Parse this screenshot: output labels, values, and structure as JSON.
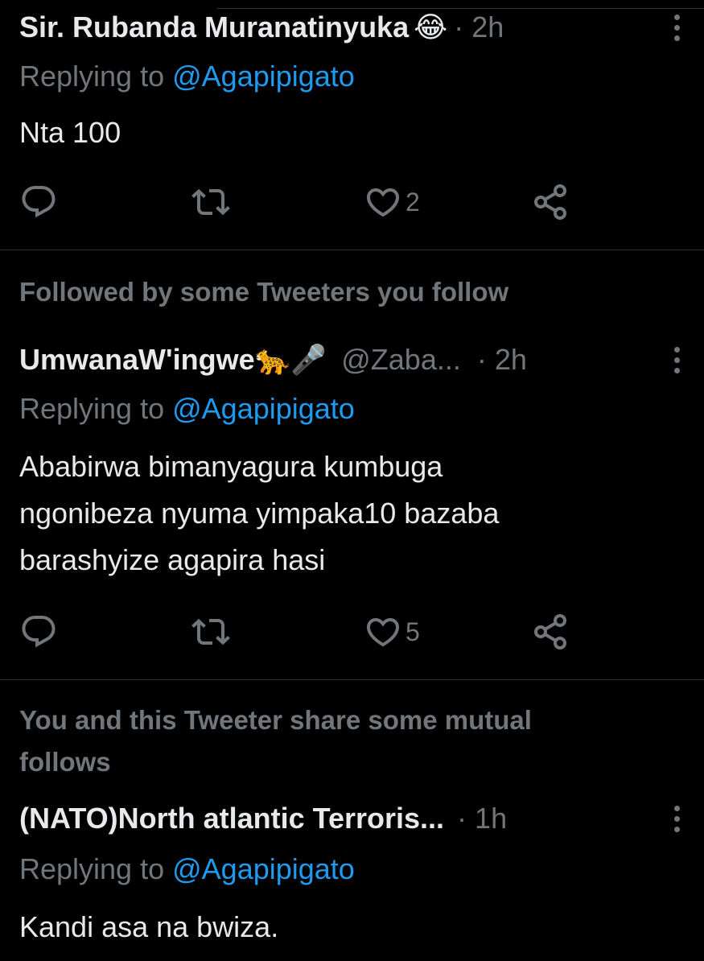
{
  "tweets": [
    {
      "name": "Sir. Rubanda Muranatinyuka",
      "emoji": "😂",
      "handle": "",
      "separator": "·",
      "time": "2h",
      "replying_prefix": "Replying to",
      "replying_to": "@Agapipigato",
      "text": "Nta 100",
      "likes": "2"
    },
    {
      "context": "Followed by some Tweeters you follow",
      "name": "UmwanaW'ingwe",
      "emoji": "🐆🎤",
      "handle": "@Zaba...",
      "separator": "·",
      "time": "2h",
      "replying_prefix": "Replying to",
      "replying_to": "@Agapipigato",
      "text_lines": [
        "Ababirwa bimanyagura kumbuga",
        "ngonibeza nyuma yimpaka10 bazaba",
        "barashyize agapira hasi"
      ],
      "likes": "5"
    },
    {
      "context_lines": [
        "You and this Tweeter share some mutual",
        "follows"
      ],
      "name": "(NATO)North atlantic Terroris...",
      "separator": "·",
      "time": "1h",
      "replying_prefix": "Replying to",
      "replying_to": "@Agapipigato",
      "text": "Kandi asa na bwiza."
    }
  ],
  "icons": {
    "reply": "reply-icon",
    "retweet": "retweet-icon",
    "like": "heart-icon",
    "share": "share-icon",
    "more": "more-icon"
  },
  "colors": {
    "background": "#000000",
    "text": "#e7e9ea",
    "muted": "#71767b",
    "link": "#1d9bf0",
    "divider": "#2f3336"
  }
}
